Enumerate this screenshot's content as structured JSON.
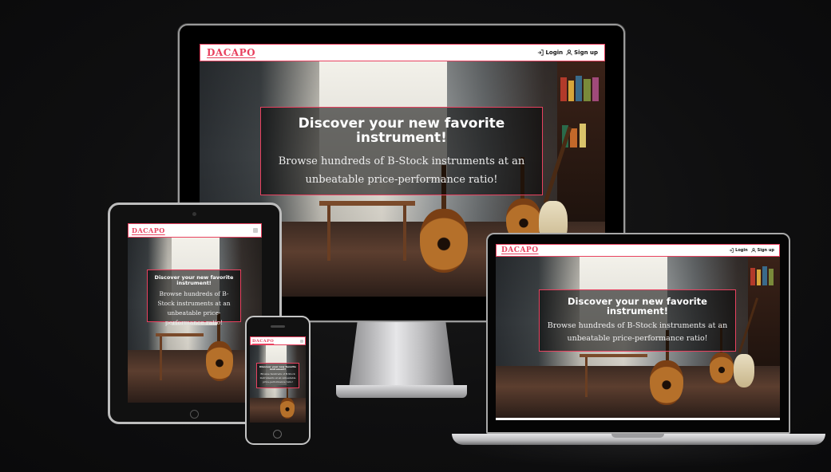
{
  "site": {
    "logo": "DACAPO",
    "login_label": "Login",
    "signup_label": "Sign up",
    "hero_title": "Discover your new favorite instrument!",
    "hero_subtitle": "Browse hundreds of B-Stock instruments at an unbeatable price-performance ratio!"
  },
  "colors": {
    "accent": "#e8415f",
    "background": "#0f0f10",
    "nav_background": "#ffffff"
  },
  "icons": {
    "login": "login-icon",
    "signup": "user-icon",
    "menu": "hamburger-icon"
  },
  "devices": [
    "desktop-monitor",
    "tablet",
    "phone",
    "laptop"
  ]
}
